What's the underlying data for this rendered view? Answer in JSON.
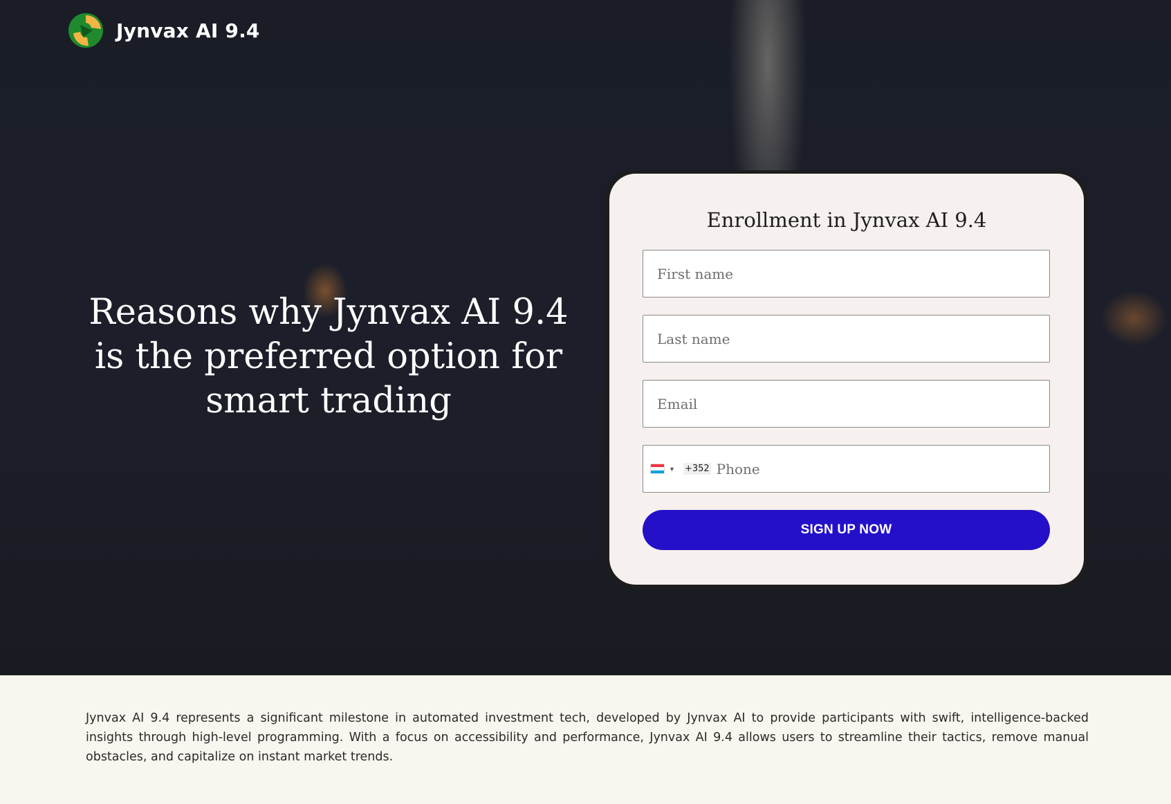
{
  "header": {
    "brand_name": "Jynvax AI 9.4",
    "logo_icon": "leaf-swirl-logo-icon"
  },
  "hero": {
    "headline": "Reasons why Jynvax AI 9.4 is the preferred option for smart trading"
  },
  "form": {
    "title": "Enrollment in Jynvax AI 9.4",
    "first_name": {
      "placeholder": "First name",
      "value": ""
    },
    "last_name": {
      "placeholder": "Last name",
      "value": ""
    },
    "email": {
      "placeholder": "Email",
      "value": ""
    },
    "phone": {
      "country_flag": "luxembourg-flag-icon",
      "dial_code": "+352",
      "placeholder": "Phone",
      "value": ""
    },
    "submit_label": "SIGN UP NOW"
  },
  "description": "Jynvax AI 9.4 represents a significant milestone in automated investment tech, developed by Jynvax AI to provide participants with swift, intelligence-backed insights through high-level programming. With a focus on accessibility and performance, Jynvax AI 9.4 allows users to streamline their tactics, remove manual obstacles, and capitalize on instant market trends.",
  "colors": {
    "accent_button": "#2410c8",
    "hero_background": "#1c1f2a",
    "card_background": "#f6f1ee",
    "page_background": "#f9f6ef"
  }
}
